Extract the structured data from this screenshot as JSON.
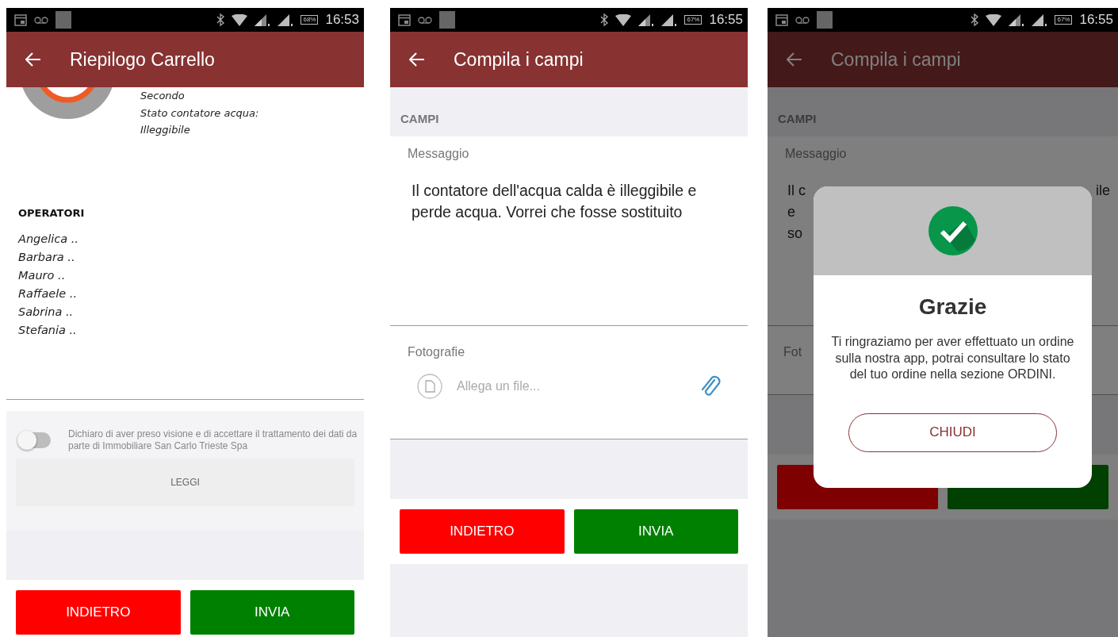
{
  "screens": [
    {
      "kind": "summary",
      "status_bar": {
        "battery": "68%",
        "time": "16:53"
      },
      "app_bar": {
        "title": "Riepilogo Carrello"
      },
      "details": [
        "Secondo",
        "Stato contatore acqua:",
        "Illeggibile"
      ],
      "operators": {
        "heading": "OPERATORI",
        "names": [
          "Angelica ..",
          "Barbara ..",
          "Mauro ..",
          "Raffaele ..",
          "Sabrina ..",
          "Stefania .."
        ]
      },
      "consent": {
        "on": false,
        "text": "Dichiaro di aver preso visione e di accettare il trattamento dei dati da parte di Immobiliare San Carlo Trieste Spa"
      },
      "read_button": "LEGGI",
      "buttons": [
        {
          "kind": "back",
          "label": "INDIETRO"
        },
        {
          "kind": "send",
          "label": "INVIA"
        }
      ]
    },
    {
      "kind": "form",
      "status_bar": {
        "battery": "67%",
        "time": "16:55"
      },
      "app_bar": {
        "title": "Compila i campi"
      },
      "section": "CAMPI",
      "message": {
        "label": "Messaggio",
        "value": "Il contatore dell'acqua calda è illeggibile e perde acqua. Vorrei che fosse sostituito"
      },
      "photos": {
        "label": "Fotografie",
        "placeholder": "Allega un file..."
      },
      "buttons": [
        {
          "kind": "back",
          "label": "INDIETRO"
        },
        {
          "kind": "send",
          "label": "INVIA"
        }
      ]
    },
    {
      "kind": "form_dialog",
      "status_bar": {
        "battery": "67%",
        "time": "16:55"
      },
      "app_bar": {
        "title": "Compila i campi"
      },
      "section": "CAMPI",
      "message": {
        "label": "Messaggio",
        "lines": [
          "Il c",
          "e",
          "so"
        ],
        "line_end": "ile"
      },
      "photos": {
        "label": "Fot"
      },
      "buttons": [
        {
          "kind": "back"
        },
        {
          "kind": "send"
        }
      ],
      "dialog": {
        "title": "Grazie",
        "text": "Ti ringraziamo per aver effettuato un ordine sulla nostra app, potrai consultare lo stato del tuo ordine nella sezione ORDINI.",
        "button": "CHIUDI"
      }
    }
  ]
}
